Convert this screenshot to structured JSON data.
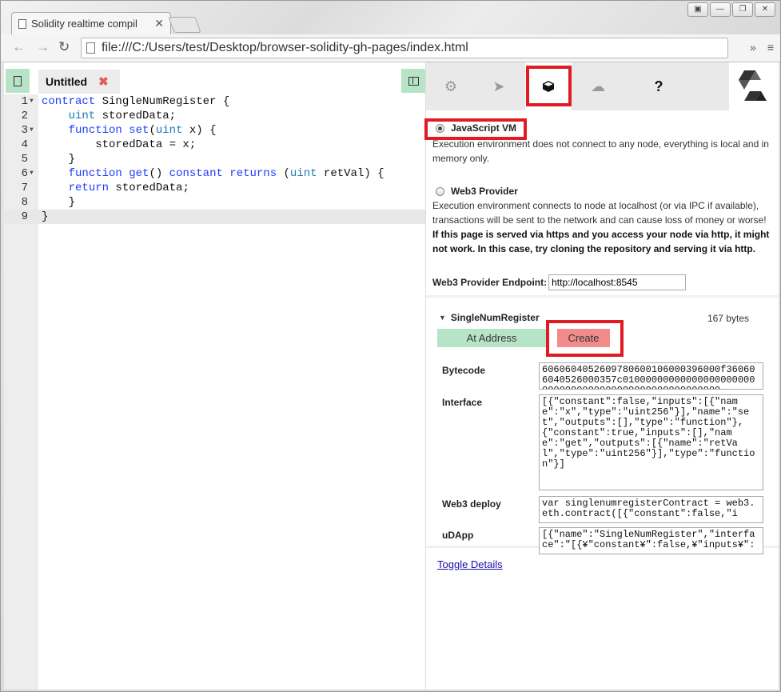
{
  "browser": {
    "tab_title": "Solidity realtime compil",
    "tab_close": "✕",
    "url": "file:///C:/Users/test/Desktop/browser-solidity-gh-pages/index.html",
    "overflow": "»",
    "menu": "≡"
  },
  "editor": {
    "file_name": "Untitled",
    "close_glyph": "✖",
    "lines": [
      {
        "n": "1",
        "fold": true
      },
      {
        "n": "2",
        "fold": false
      },
      {
        "n": "3",
        "fold": true
      },
      {
        "n": "4",
        "fold": false
      },
      {
        "n": "5",
        "fold": false
      },
      {
        "n": "6",
        "fold": true
      },
      {
        "n": "7",
        "fold": false
      },
      {
        "n": "8",
        "fold": false
      },
      {
        "n": "9",
        "fold": false
      }
    ],
    "code": [
      "contract SingleNumRegister {",
      "    uint storedData;",
      "    function set(uint x) {",
      "        storedData = x;",
      "    }",
      "    function get() constant returns (uint retVal) {",
      "    return storedData;",
      "    }",
      "}"
    ]
  },
  "right_panel": {
    "tabs": [
      {
        "icon": "gear-icon",
        "glyph": "⚙"
      },
      {
        "icon": "paper-plane-icon",
        "glyph": "➤"
      },
      {
        "icon": "cube-icon",
        "glyph": "■"
      },
      {
        "icon": "cloud-upload-icon",
        "glyph": "☁"
      },
      {
        "icon": "help-icon",
        "glyph": "?"
      }
    ],
    "env": {
      "js_vm_label": "JavaScript VM",
      "js_vm_desc": "Execution environment does not connect to any node, everything is local and in memory only.",
      "web3_label": "Web3 Provider",
      "web3_desc": "Execution environment connects to node at localhost (or via IPC if available), transactions will be sent to the network and can cause loss of money or worse!",
      "web3_warning": "If this page is served via https and you access your node via http, it might not work. In this case, try cloning the repository and serving it via http.",
      "endpoint_label": "Web3 Provider Endpoint:",
      "endpoint_value": "http://localhost:8545"
    },
    "contract": {
      "name": "SingleNumRegister",
      "size": "167 bytes",
      "at_address_label": "At Address",
      "create_label": "Create",
      "bytecode_label": "Bytecode",
      "bytecode_value": "6060604052609780600106000396000f360606040526000357c010000000000000000000000000000000000000000000000000000",
      "interface_label": "Interface",
      "interface_value": "[{\"constant\":false,\"inputs\":[{\"name\":\"x\",\"type\":\"uint256\"}],\"name\":\"set\",\"outputs\":[],\"type\":\"function\"},{\"constant\":true,\"inputs\":[],\"name\":\"get\",\"outputs\":[{\"name\":\"retVal\",\"type\":\"uint256\"}],\"type\":\"function\"}]",
      "web3deploy_label": "Web3 deploy",
      "web3deploy_value": "var singlenumregisterContract = web3.eth.contract([{\"constant\":false,\"i",
      "udapp_label": "uDApp",
      "udapp_value": "[{\"name\":\"SingleNumRegister\",\"interface\":\"[{¥\"constant¥\":false,¥\"inputs¥\":",
      "toggle_label": "Toggle Details"
    }
  }
}
